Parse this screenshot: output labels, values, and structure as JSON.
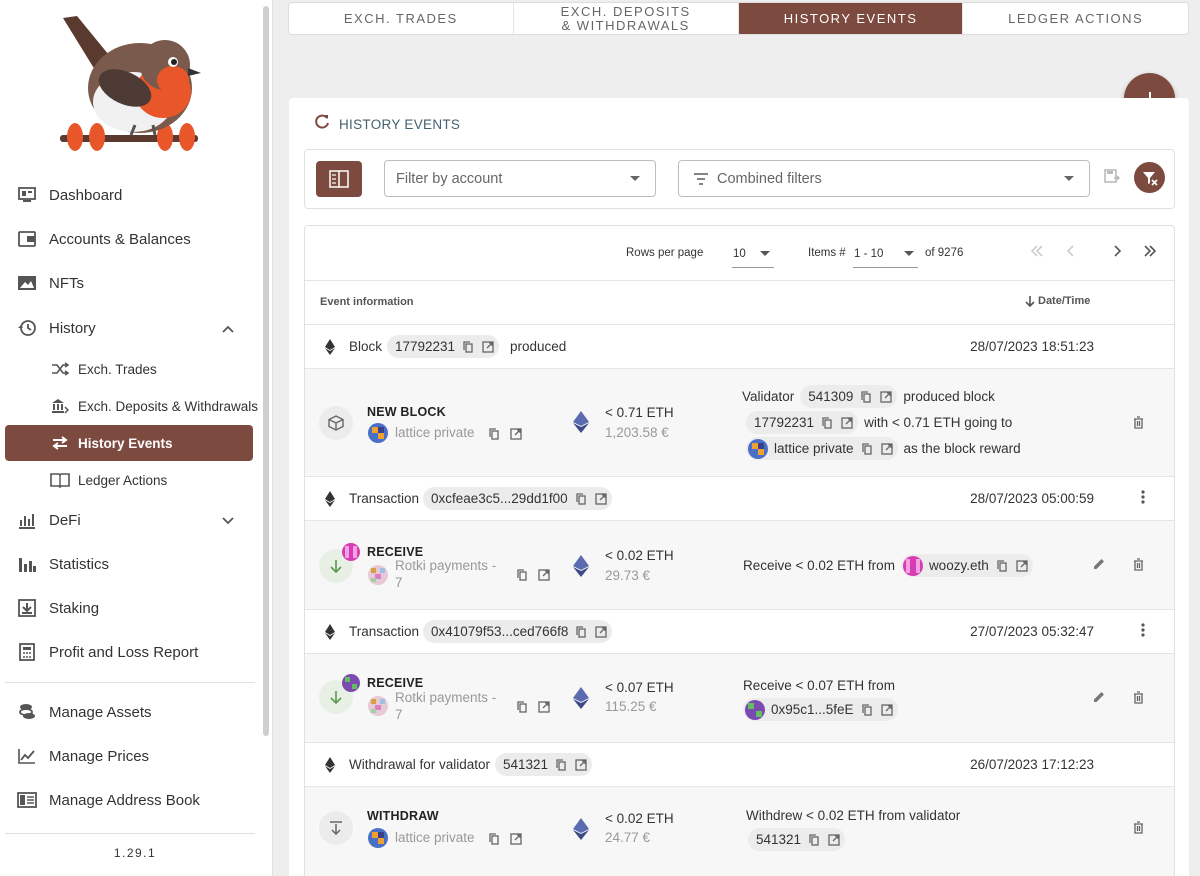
{
  "sidebar": {
    "items": [
      {
        "label": "Dashboard",
        "icon": "dashboard-icon"
      },
      {
        "label": "Accounts & Balances",
        "icon": "wallet-icon"
      },
      {
        "label": "NFTs",
        "icon": "image-icon"
      },
      {
        "label": "History",
        "icon": "history-icon"
      },
      {
        "label": "DeFi",
        "icon": "defi-icon"
      },
      {
        "label": "Statistics",
        "icon": "bar-chart-icon"
      },
      {
        "label": "Staking",
        "icon": "staking-icon"
      },
      {
        "label": "Profit and Loss Report",
        "icon": "calculator-icon"
      },
      {
        "label": "Manage Assets",
        "icon": "coins-icon"
      },
      {
        "label": "Manage Prices",
        "icon": "line-chart-icon"
      },
      {
        "label": "Manage Address Book",
        "icon": "address-book-icon"
      }
    ],
    "history_sub": [
      {
        "label": "Exch. Trades",
        "icon": "shuffle-icon"
      },
      {
        "label": "Exch. Deposits & Withdrawals",
        "icon": "bank-transfer-icon"
      },
      {
        "label": "History Events",
        "icon": "swap-icon"
      },
      {
        "label": "Ledger Actions",
        "icon": "book-icon"
      }
    ],
    "version": "1.29.1"
  },
  "tabs": [
    "EXCH. TRADES",
    "EXCH. DEPOSITS & WITHDRAWALS",
    "HISTORY EVENTS",
    "LEDGER ACTIONS"
  ],
  "active_tab": "HISTORY EVENTS",
  "card": {
    "title": "HISTORY EVENTS",
    "filter_account_placeholder": "Filter by account",
    "combined_filters_placeholder": "Combined filters"
  },
  "pager": {
    "rows_per_page_label": "Rows per page",
    "rows_per_page": "10",
    "items_label": "Items #",
    "items_range": "1 - 10",
    "total": "of 9276"
  },
  "table": {
    "col_event": "Event information",
    "col_date": "Date/Time"
  },
  "groups": [
    {
      "label": "Block",
      "id": "17792231",
      "suffix": "produced",
      "date": "28/07/2023 18:51:23",
      "event": {
        "type": "NEW BLOCK",
        "account": "lattice private",
        "amount": "< 0.71 ETH",
        "fiat": "1,203.58 €",
        "desc": {
          "line1_prefix": "Validator",
          "validator": "541309",
          "line1_suffix": "produced block",
          "block": "17792231",
          "line2_suffix": "with < 0.71 ETH going to",
          "recipient": "lattice private",
          "line3_suffix": "as the block reward"
        }
      }
    },
    {
      "label": "Transaction",
      "id": "0xcfeae3c5...29dd1f00",
      "date": "28/07/2023 05:00:59",
      "event": {
        "type": "RECEIVE",
        "account": "Rotki payments -",
        "account2": "7",
        "amount": "< 0.02 ETH",
        "fiat": "29.73 €",
        "desc": {
          "prefix": "Receive < 0.02 ETH from",
          "from": "woozy.eth"
        }
      }
    },
    {
      "label": "Transaction",
      "id": "0x41079f53...ced766f8",
      "date": "27/07/2023 05:32:47",
      "event": {
        "type": "RECEIVE",
        "account": "Rotki payments -",
        "account2": "7",
        "amount": "< 0.07 ETH",
        "fiat": "115.25 €",
        "desc": {
          "prefix": "Receive < 0.07 ETH from",
          "from": "0x95c1...5feE"
        }
      }
    },
    {
      "label": "Withdrawal for validator",
      "id": "541321",
      "date": "26/07/2023 17:12:23",
      "event": {
        "type": "WITHDRAW",
        "account": "lattice private",
        "amount": "< 0.02 ETH",
        "fiat": "24.77 €",
        "desc": {
          "prefix": "Withdrew < 0.02 ETH from validator",
          "validator": "541321"
        }
      }
    }
  ],
  "colors": {
    "accent": "#7d4a3f",
    "background": "#eeeeee"
  }
}
